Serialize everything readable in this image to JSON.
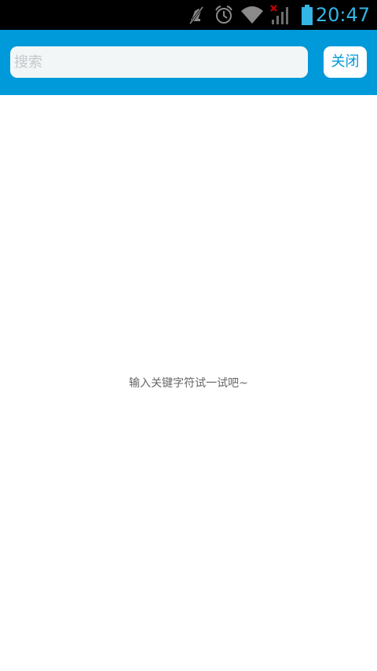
{
  "status_bar": {
    "time": "20:47",
    "icons": [
      "mute-icon",
      "alarm-icon",
      "wifi-icon",
      "signal-no-service-icon",
      "battery-icon"
    ],
    "time_color": "#33b5e5"
  },
  "header": {
    "background_color": "#0099d9",
    "search": {
      "placeholder": "搜索",
      "value": ""
    },
    "close_label": "关闭"
  },
  "main": {
    "empty_hint": "输入关键字符试一试吧~"
  }
}
